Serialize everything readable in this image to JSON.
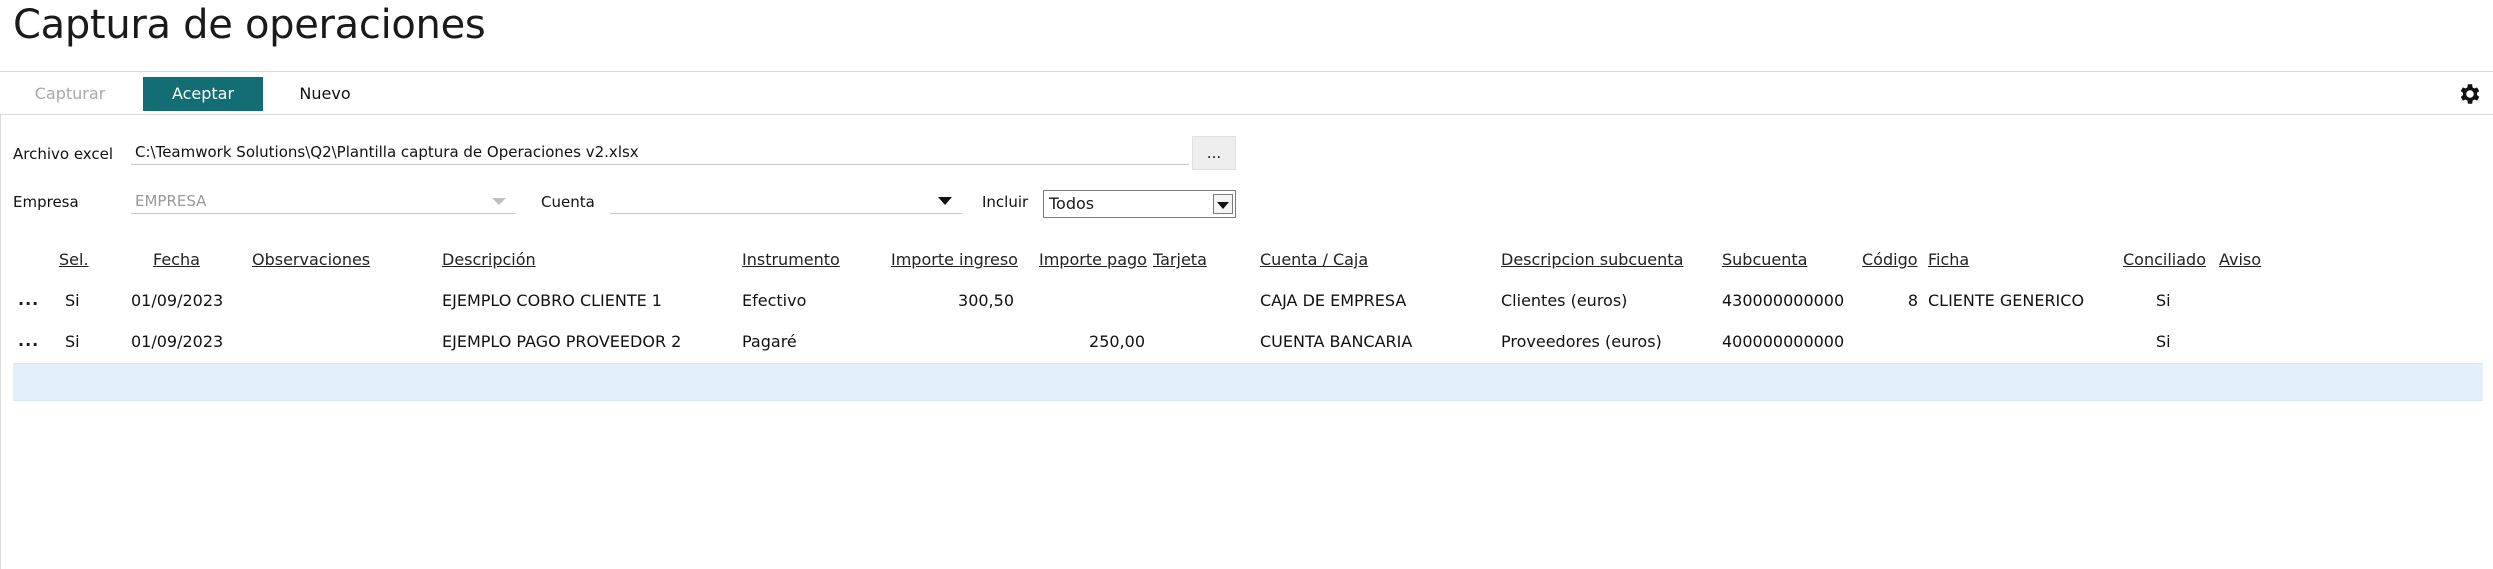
{
  "page": {
    "title": "Captura de operaciones"
  },
  "toolbar": {
    "capturar": "Capturar",
    "aceptar": "Aceptar",
    "nuevo": "Nuevo"
  },
  "form": {
    "archivo_label": "Archivo excel",
    "archivo_value": "C:\\Teamwork Solutions\\Q2\\Plantilla captura de Operaciones v2.xlsx",
    "browse_label": "...",
    "empresa_label": "Empresa",
    "empresa_value": "EMPRESA",
    "cuenta_label": "Cuenta",
    "cuenta_value": "",
    "incluir_label": "Incluir",
    "incluir_value": "Todos"
  },
  "table": {
    "headers": {
      "sel": "Sel.",
      "fecha": "Fecha",
      "observaciones": "Observaciones",
      "descripcion": "Descripción",
      "instrumento": "Instrumento",
      "importe_ingreso": "Importe ingreso",
      "importe_pago": "Importe pago",
      "tarjeta": "Tarjeta",
      "cuenta_caja": "Cuenta / Caja",
      "desc_subcuenta": "Descripcion subcuenta",
      "subcuenta": "Subcuenta",
      "codigo": "Código",
      "ficha": "Ficha",
      "conciliado": "Conciliado",
      "aviso": "Aviso"
    },
    "rows": [
      {
        "menu": "...",
        "sel": "Si",
        "fecha": "01/09/2023",
        "observaciones": "",
        "descripcion": "EJEMPLO COBRO CLIENTE 1",
        "instrumento": "Efectivo",
        "importe_ingreso": "300,50",
        "importe_pago": "",
        "tarjeta": "",
        "cuenta_caja": "CAJA DE EMPRESA",
        "desc_subcuenta": "Clientes (euros)",
        "subcuenta": "430000000000",
        "codigo": "8",
        "ficha": "CLIENTE GENERICO",
        "conciliado": "Si",
        "aviso": ""
      },
      {
        "menu": "...",
        "sel": "Si",
        "fecha": "01/09/2023",
        "observaciones": "",
        "descripcion": "EJEMPLO PAGO PROVEEDOR 2",
        "instrumento": "Pagaré",
        "importe_ingreso": "",
        "importe_pago": "250,00",
        "tarjeta": "",
        "cuenta_caja": "CUENTA BANCARIA",
        "desc_subcuenta": "Proveedores (euros)",
        "subcuenta": "400000000000",
        "codigo": "",
        "ficha": "",
        "conciliado": "Si",
        "aviso": ""
      }
    ]
  },
  "colors": {
    "accent": "#126e74",
    "new_row_bg": "#e3f0fb",
    "disabled_text": "#a8a8a8"
  },
  "icons": {
    "settings": "gear-icon",
    "combo_arrow": "chevron-down-icon"
  }
}
